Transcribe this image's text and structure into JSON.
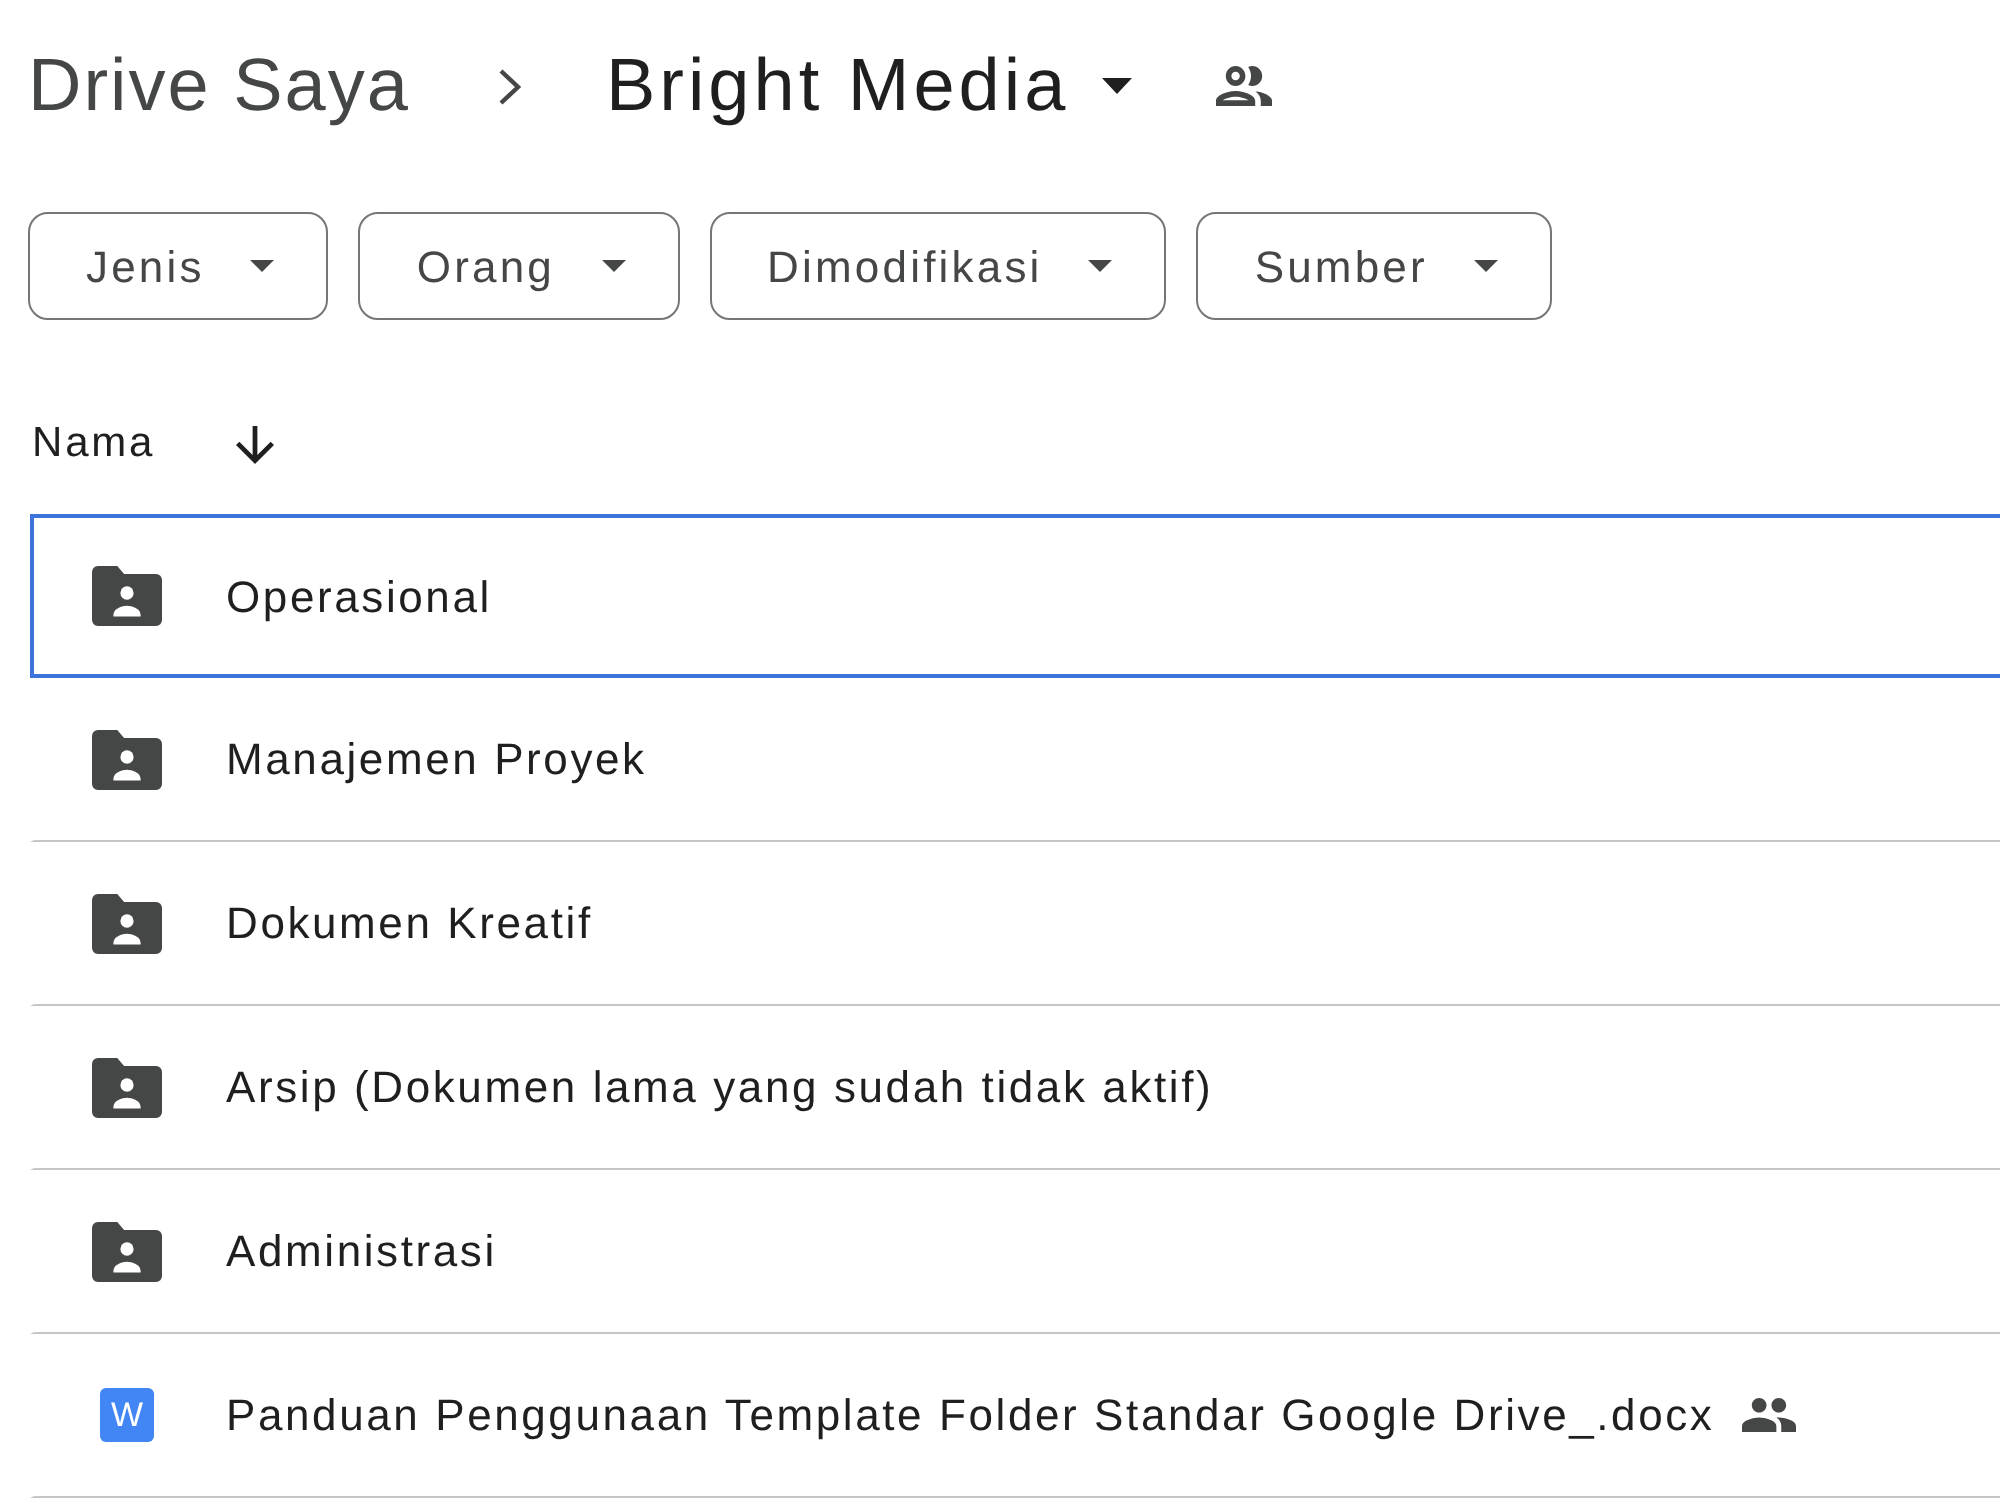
{
  "breadcrumb": {
    "parent": "Drive Saya",
    "current": "Bright Media",
    "shared": true
  },
  "filters": [
    {
      "label": "Jenis"
    },
    {
      "label": "Orang"
    },
    {
      "label": "Dimodifikasi"
    },
    {
      "label": "Sumber"
    }
  ],
  "list_header": {
    "column": "Nama",
    "sort_descending": true
  },
  "rows": [
    {
      "name": "Operasional",
      "kind": "folder",
      "selected": true,
      "shared": false
    },
    {
      "name": "Manajemen Proyek",
      "kind": "folder",
      "selected": false,
      "shared": false
    },
    {
      "name": "Dokumen Kreatif",
      "kind": "folder",
      "selected": false,
      "shared": false
    },
    {
      "name": "Arsip (Dokumen lama yang sudah tidak aktif)",
      "kind": "folder",
      "selected": false,
      "shared": false
    },
    {
      "name": "Administrasi",
      "kind": "folder",
      "selected": false,
      "shared": false
    },
    {
      "name": "Panduan Penggunaan Template Folder Standar Google Drive_.docx",
      "kind": "document",
      "badge": "W",
      "selected": false,
      "shared": true
    }
  ]
}
